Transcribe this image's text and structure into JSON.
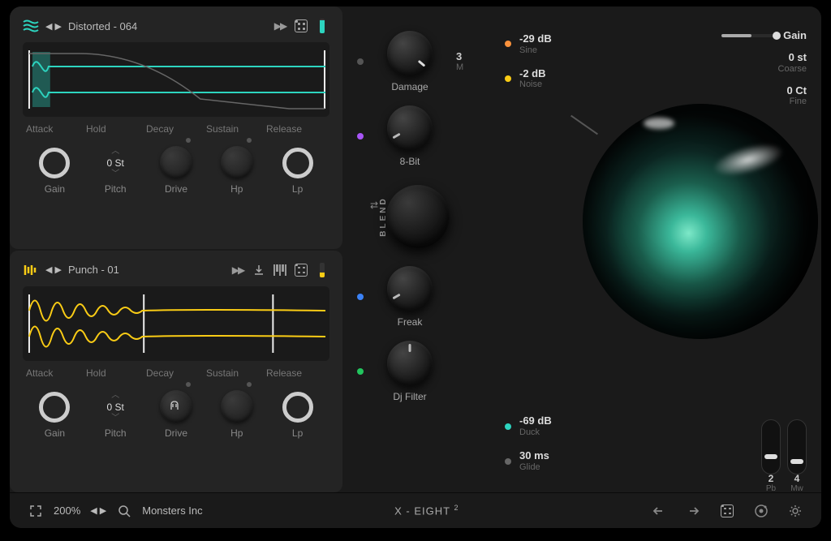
{
  "osc1": {
    "preset": "Distorted - 064",
    "env": {
      "attack": "Attack",
      "hold": "Hold",
      "decay": "Decay",
      "sustain": "Sustain",
      "release": "Release"
    },
    "knobs": {
      "gain": "Gain",
      "pitch_label": "Pitch",
      "pitch_value": "0 St",
      "drive": "Drive",
      "hp": "Hp",
      "lp": "Lp"
    }
  },
  "osc2": {
    "preset": "Punch - 01",
    "env": {
      "attack": "Attack",
      "hold": "Hold",
      "decay": "Decay",
      "sustain": "Sustain",
      "release": "Release"
    },
    "knobs": {
      "gain": "Gain",
      "pitch_label": "Pitch",
      "pitch_value": "0 St",
      "drive": "Drive",
      "hp": "Hp",
      "lp": "Lp"
    }
  },
  "fx": {
    "damage": {
      "label": "Damage",
      "value": "3",
      "unit": "M"
    },
    "eightbit": {
      "label": "8-Bit"
    },
    "blend": {
      "label": "BLEND"
    },
    "freak": {
      "label": "Freak"
    },
    "dj": {
      "label": "Dj Filter"
    }
  },
  "readouts": {
    "sine": {
      "value": "-29 dB",
      "label": "Sine"
    },
    "noise": {
      "value": "-2 dB",
      "label": "Noise"
    },
    "duck": {
      "value": "-69 dB",
      "label": "Duck"
    },
    "glide": {
      "value": "30 ms",
      "label": "Glide"
    },
    "gain": {
      "label": "Gain"
    },
    "coarse": {
      "value": "0 st",
      "label": "Coarse"
    },
    "fine": {
      "value": "0 Ct",
      "label": "Fine"
    }
  },
  "wheels": {
    "pb": {
      "value": "2",
      "label": "Pb"
    },
    "mw": {
      "value": "4",
      "label": "Mw"
    }
  },
  "bottom": {
    "zoom": "200%",
    "preset": "Monsters Inc",
    "title": "X - EIGHT",
    "title_sup": "2"
  }
}
